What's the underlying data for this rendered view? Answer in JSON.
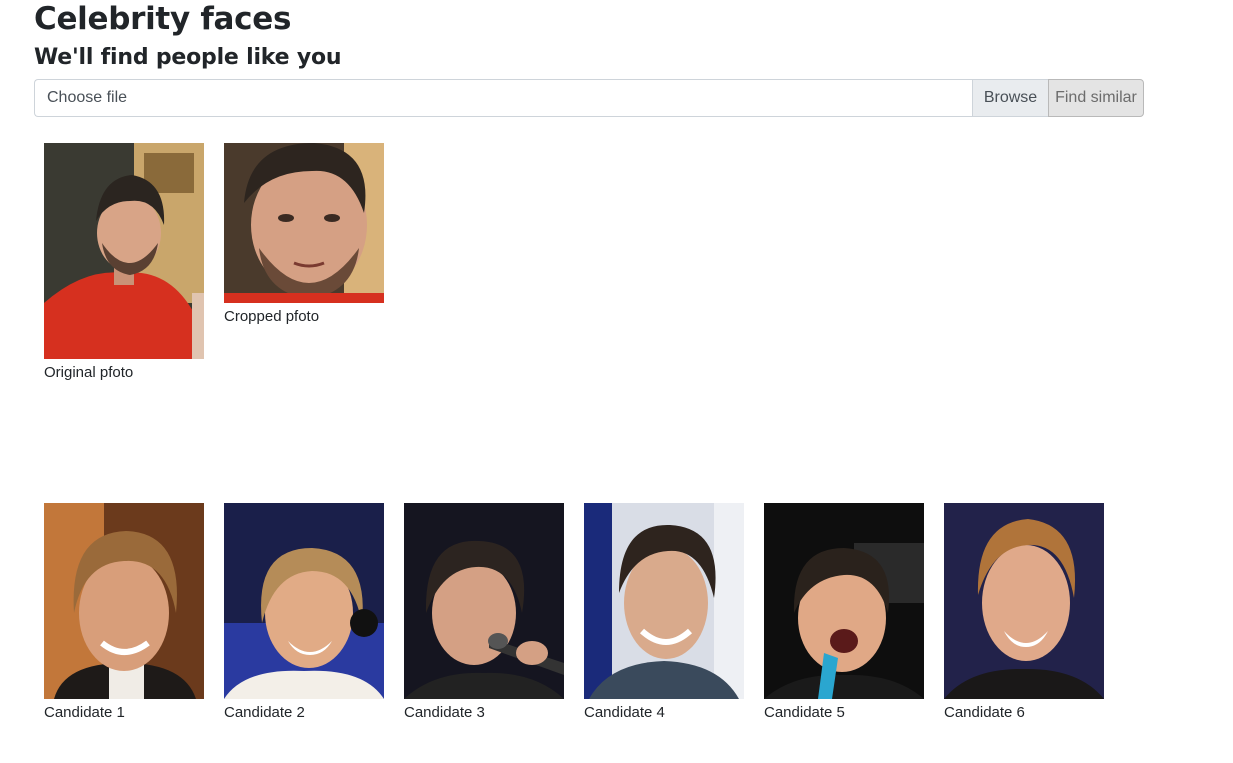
{
  "header": {
    "title": "Celebrity faces",
    "subtitle": "We'll find people like you"
  },
  "upload": {
    "placeholder": "Choose file",
    "browse_label": "Browse",
    "find_label": "Find similar"
  },
  "input_photos": [
    {
      "caption": "Original pfoto"
    },
    {
      "caption": "Cropped pfoto"
    }
  ],
  "candidates": [
    {
      "caption": "Candidate 1"
    },
    {
      "caption": "Candidate 2"
    },
    {
      "caption": "Candidate 3"
    },
    {
      "caption": "Candidate 4"
    },
    {
      "caption": "Candidate 5"
    },
    {
      "caption": "Candidate 6"
    }
  ],
  "colors": {
    "text": "#212529",
    "input_border": "#ced4da",
    "addon_bg": "#e9ecef",
    "button_bg": "#e4e4e4"
  }
}
